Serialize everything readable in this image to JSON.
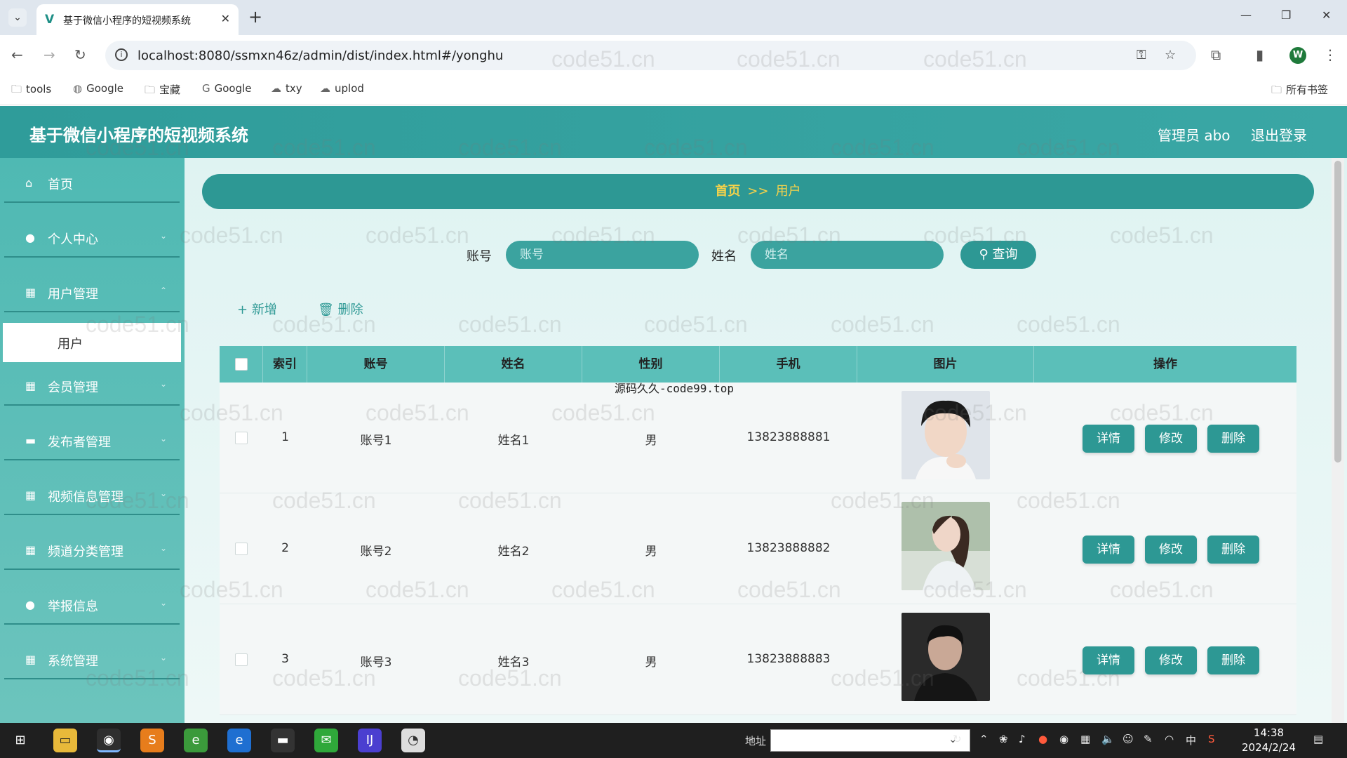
{
  "browser": {
    "tab_title": "基于微信小程序的短视频系统",
    "url": "localhost:8080/ssmxn46z/admin/dist/index.html#/yonghu",
    "bookmarks": [
      {
        "label": "tools",
        "icon": "folder-icon"
      },
      {
        "label": "Google",
        "icon": "globe-icon"
      },
      {
        "label": "宝藏",
        "icon": "folder-icon"
      },
      {
        "label": "Google",
        "icon": "google-icon"
      },
      {
        "label": "txy",
        "icon": "cloud-icon"
      },
      {
        "label": "uplod",
        "icon": "cloud-icon"
      }
    ],
    "all_bookmarks": "所有书签",
    "profile_initial": "W"
  },
  "header": {
    "title": "基于微信小程序的短视频系统",
    "admin": "管理员 abo",
    "logout": "退出登录"
  },
  "sidebar": {
    "items": [
      {
        "label": "首页",
        "icon": "home-icon"
      },
      {
        "label": "个人中心",
        "icon": "user-icon"
      },
      {
        "label": "用户管理",
        "icon": "grid-icon"
      },
      {
        "label": "会员管理",
        "icon": "grid-icon"
      },
      {
        "label": "发布者管理",
        "icon": "monitor-icon"
      },
      {
        "label": "视频信息管理",
        "icon": "grid-icon"
      },
      {
        "label": "频道分类管理",
        "icon": "grid-icon"
      },
      {
        "label": "举报信息",
        "icon": "user-icon"
      },
      {
        "label": "系统管理",
        "icon": "grid-icon"
      }
    ],
    "active_sub": "用户"
  },
  "breadcrumb": {
    "home": "首页",
    "sep": ">>",
    "current": "用户"
  },
  "search": {
    "account_label": "账号",
    "account_placeholder": "账号",
    "name_label": "姓名",
    "name_placeholder": "姓名",
    "button": "查询"
  },
  "actions": {
    "add": "新增",
    "delete": "删除"
  },
  "table": {
    "headers": [
      "索引",
      "账号",
      "姓名",
      "性别",
      "手机",
      "图片",
      "操作"
    ],
    "rows": [
      {
        "index": "1",
        "account": "账号1",
        "name": "姓名1",
        "gender": "男",
        "phone": "13823888881"
      },
      {
        "index": "2",
        "account": "账号2",
        "name": "姓名2",
        "gender": "男",
        "phone": "13823888882"
      },
      {
        "index": "3",
        "account": "账号3",
        "name": "姓名3",
        "gender": "男",
        "phone": "13823888883"
      }
    ],
    "op_buttons": {
      "detail": "详情",
      "edit": "修改",
      "delete": "删除"
    }
  },
  "overlay_text": "源码久久-code99.top",
  "watermark": "code51.cn",
  "taskbar": {
    "address_label": "地址",
    "clock_time": "14:38",
    "clock_date": "2024/2/24",
    "ime": "中"
  },
  "colors": {
    "accent": "#2d9894",
    "breadcrumb_text": "#f6d24a"
  }
}
